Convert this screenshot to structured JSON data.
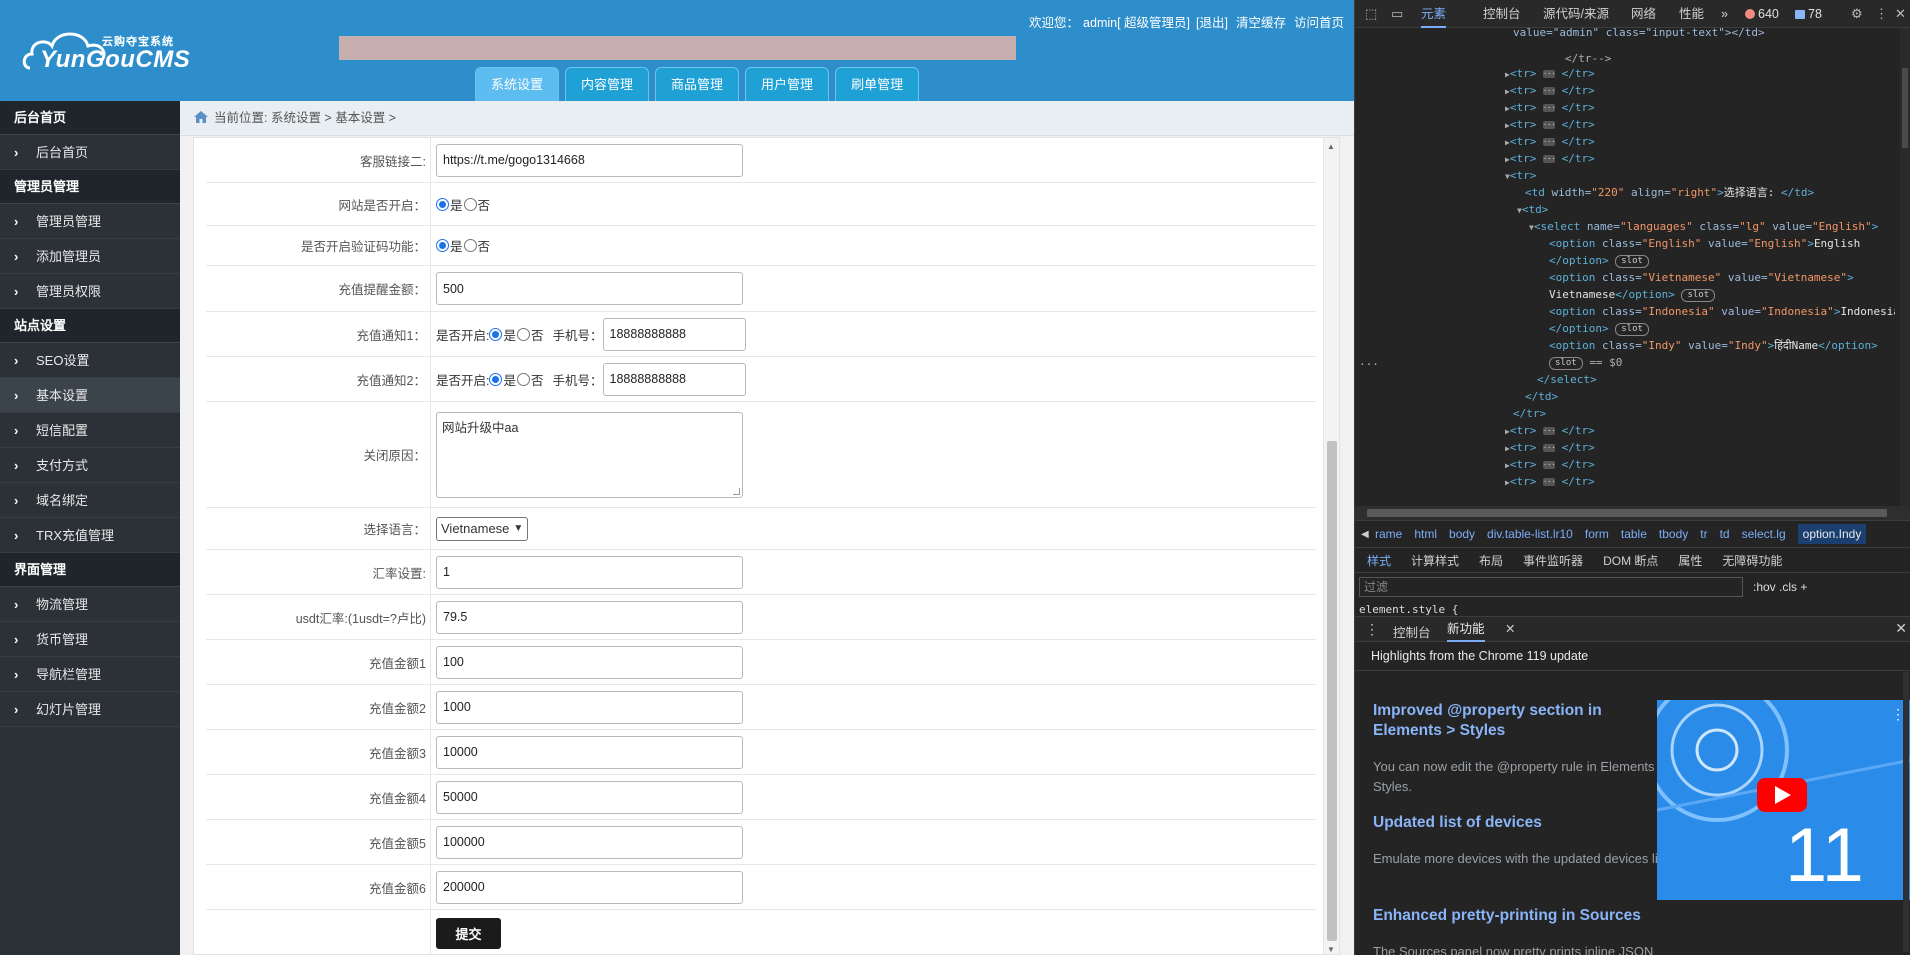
{
  "header": {
    "logo_small": "云购夺宝系统",
    "logo_big": "YunGouCMS",
    "welcome_label": "欢迎您：",
    "user": "admin[ 超级管理员]",
    "logout": "[退出]",
    "clear_cache": "清空缓存",
    "visit_home": "访问首页",
    "tabs": [
      "系统设置",
      "内容管理",
      "商品管理",
      "用户管理",
      "刷单管理"
    ]
  },
  "sidebar": {
    "groups": [
      {
        "title": "后台首页",
        "items": [
          "后台首页"
        ]
      },
      {
        "title": "管理员管理",
        "items": [
          "管理员管理",
          "添加管理员",
          "管理员权限"
        ]
      },
      {
        "title": "站点设置",
        "items": [
          "SEO设置",
          "基本设置",
          "短信配置",
          "支付方式",
          "域名绑定",
          "TRX充值管理"
        ]
      },
      {
        "title": "界面管理",
        "items": [
          "物流管理",
          "货币管理",
          "导航栏管理",
          "幻灯片管理"
        ]
      }
    ]
  },
  "breadcrumb": "当前位置: 系统设置 > 基本设置 >",
  "form": {
    "kefu2_label": "客服链接二:",
    "kefu2_value": "https://t.me/gogo1314668",
    "site_open_label": "网站是否开启：",
    "captcha_label": "是否开启验证码功能：",
    "yes": "是",
    "no": "否",
    "recharge_reminder_label": "充值提醒金额：",
    "recharge_reminder_value": "500",
    "notify1_label": "充值通知1：",
    "notify2_label": "充值通知2：",
    "notify_open": "是否开启:",
    "phone_label": "手机号：",
    "notify1_phone": "18888888888",
    "notify2_phone": "18888888888",
    "close_reason_label": "关闭原因：",
    "close_reason_value": "网站升级中aa",
    "language_label": "选择语言：",
    "language_value": "Vietnamese",
    "rate_label": "汇率设置:",
    "rate_value": "1",
    "usdt_label": "usdt汇率:(1usdt=?卢比)",
    "usdt_value": "79.5",
    "amounts": [
      {
        "label": "充值金额1",
        "value": "100"
      },
      {
        "label": "充值金额2",
        "value": "1000"
      },
      {
        "label": "充值金额3",
        "value": "10000"
      },
      {
        "label": "充值金额4",
        "value": "50000"
      },
      {
        "label": "充值金额5",
        "value": "100000"
      },
      {
        "label": "充值金额6",
        "value": "200000"
      }
    ],
    "submit": "提交"
  },
  "devtools": {
    "tabs": [
      "元素",
      "控制台",
      "源代码/来源",
      "网络",
      "性能"
    ],
    "more": "»",
    "errors": "640",
    "messages": "78",
    "dom_top_line": "value=\"admin\"  class=\"input-text\"></td>",
    "dom_comment": "</tr-->",
    "td_label_text": "选择语言: ",
    "options": [
      {
        "cls": "English",
        "val": "English",
        "text": "English"
      },
      {
        "cls": "Vietnamese",
        "val": "Vietnamese",
        "text": "Vietnamese"
      },
      {
        "cls": "Indonesia",
        "val": "Indonesia",
        "text": "Indonesia"
      },
      {
        "cls": "Indy",
        "val": "Indy",
        "text": "हिंदीName"
      }
    ],
    "select_eq": "== $0",
    "crumbs": [
      "rame",
      "html",
      "body",
      "div.table-list.lr10",
      "form",
      "table",
      "tbody",
      "tr",
      "td",
      "select.lg",
      "option.Indy"
    ],
    "style_tabs": [
      "样式",
      "计算样式",
      "布局",
      "事件监听器",
      "DOM 断点",
      "属性",
      "无障碍功能"
    ],
    "filter_placeholder": "过滤",
    "filter_tools": ":hov  .cls  +",
    "element_style": "element.style {",
    "drawer_tabs": [
      "控制台",
      "新功能"
    ],
    "highlights": "Highlights from the Chrome 119 update",
    "news": [
      {
        "title": "Improved @property section in Elements > Styles",
        "body": "You can now edit the @property rule in Elements > Styles."
      },
      {
        "title": "Updated list of devices",
        "body": "Emulate more devices with the updated devices list."
      },
      {
        "title": "Enhanced pretty-printing in Sources",
        "body": "The Sources panel now pretty prints inline JSON"
      }
    ],
    "thumb_number": "11"
  }
}
